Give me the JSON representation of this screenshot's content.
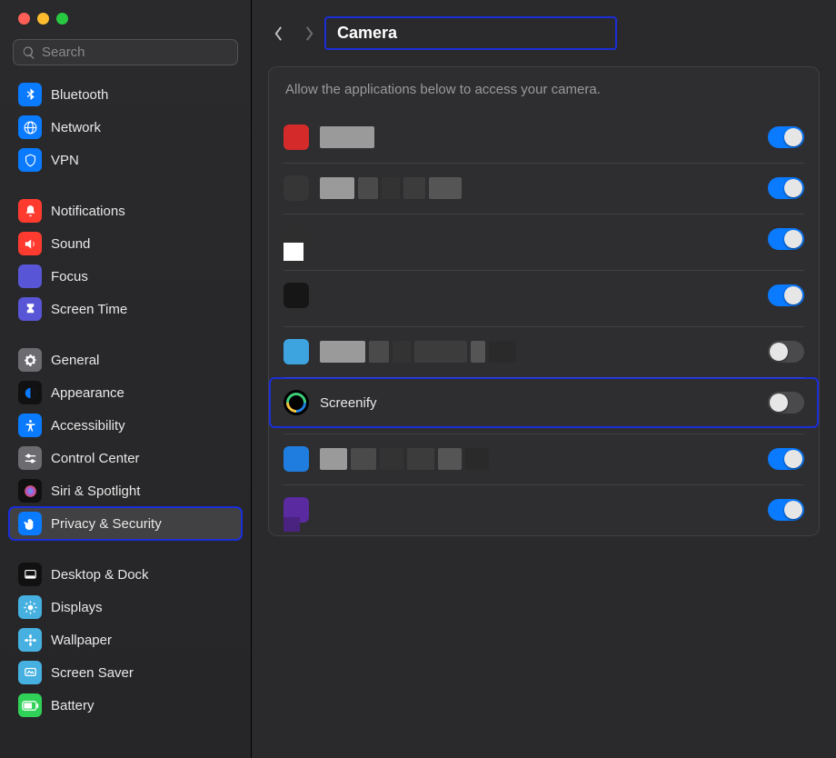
{
  "sidebar": {
    "search_placeholder": "Search",
    "groups": [
      {
        "items": [
          {
            "label": "Bluetooth",
            "icon": "bluetooth",
            "bg": "ic-blue"
          },
          {
            "label": "Network",
            "icon": "globe",
            "bg": "ic-blue"
          },
          {
            "label": "VPN",
            "icon": "shield",
            "bg": "ic-blue"
          }
        ]
      },
      {
        "items": [
          {
            "label": "Notifications",
            "icon": "bell",
            "bg": "ic-red"
          },
          {
            "label": "Sound",
            "icon": "speaker",
            "bg": "ic-red"
          },
          {
            "label": "Focus",
            "icon": "moon",
            "bg": "ic-focus"
          },
          {
            "label": "Screen Time",
            "icon": "hourglass",
            "bg": "ic-st"
          }
        ]
      },
      {
        "items": [
          {
            "label": "General",
            "icon": "gear",
            "bg": "ic-gen"
          },
          {
            "label": "Appearance",
            "icon": "appearance",
            "bg": "ic-black"
          },
          {
            "label": "Accessibility",
            "icon": "accessibility",
            "bg": "ic-blue"
          },
          {
            "label": "Control Center",
            "icon": "sliders",
            "bg": "ic-grey"
          },
          {
            "label": "Siri & Spotlight",
            "icon": "siri",
            "bg": "ic-black"
          },
          {
            "label": "Privacy & Security",
            "icon": "hand",
            "bg": "ic-blue",
            "selected": true,
            "highlighted": true
          }
        ]
      },
      {
        "items": [
          {
            "label": "Desktop & Dock",
            "icon": "dock",
            "bg": "ic-black"
          },
          {
            "label": "Displays",
            "icon": "sun",
            "bg": "ic-teal"
          },
          {
            "label": "Wallpaper",
            "icon": "flower",
            "bg": "ic-teal"
          },
          {
            "label": "Screen Saver",
            "icon": "screensaver",
            "bg": "ic-teal"
          },
          {
            "label": "Battery",
            "icon": "battery",
            "bg": "ic-green"
          }
        ]
      }
    ]
  },
  "header": {
    "title": "Camera"
  },
  "main": {
    "description": "Allow the applications below to access your camera.",
    "apps": [
      {
        "name": "",
        "redacted": true,
        "icon_color": "#d42a2a",
        "toggle": true,
        "blocks": [
          60
        ]
      },
      {
        "name": "",
        "redacted": true,
        "icon_color": "#363636",
        "toggle": true,
        "blocks": [
          38,
          22,
          20,
          24,
          36
        ]
      },
      {
        "name": "",
        "redacted": true,
        "icon_color": "#2e2e2e",
        "icon_square_below": true,
        "toggle": true,
        "blocks": []
      },
      {
        "name": "",
        "redacted": true,
        "icon_color": "#161616",
        "toggle": true,
        "spaced": true,
        "blocks": []
      },
      {
        "name": "",
        "redacted": true,
        "icon_color": "#3ea4e0",
        "toggle": false,
        "spaced": true,
        "blocks": [
          50,
          22,
          20,
          58,
          16,
          30
        ]
      },
      {
        "name": "Screenify",
        "redacted": false,
        "toggle": false,
        "highlighted": true,
        "screenify_icon": true
      },
      {
        "name": "",
        "redacted": true,
        "icon_color": "#1f7de0",
        "toggle": true,
        "spaced": true,
        "blocks": [
          30,
          28,
          26,
          30,
          26,
          26
        ]
      },
      {
        "name": "",
        "redacted": true,
        "icon_color": "#5a2aa0",
        "toggle": true,
        "square_below_left": true,
        "blocks": []
      }
    ]
  }
}
